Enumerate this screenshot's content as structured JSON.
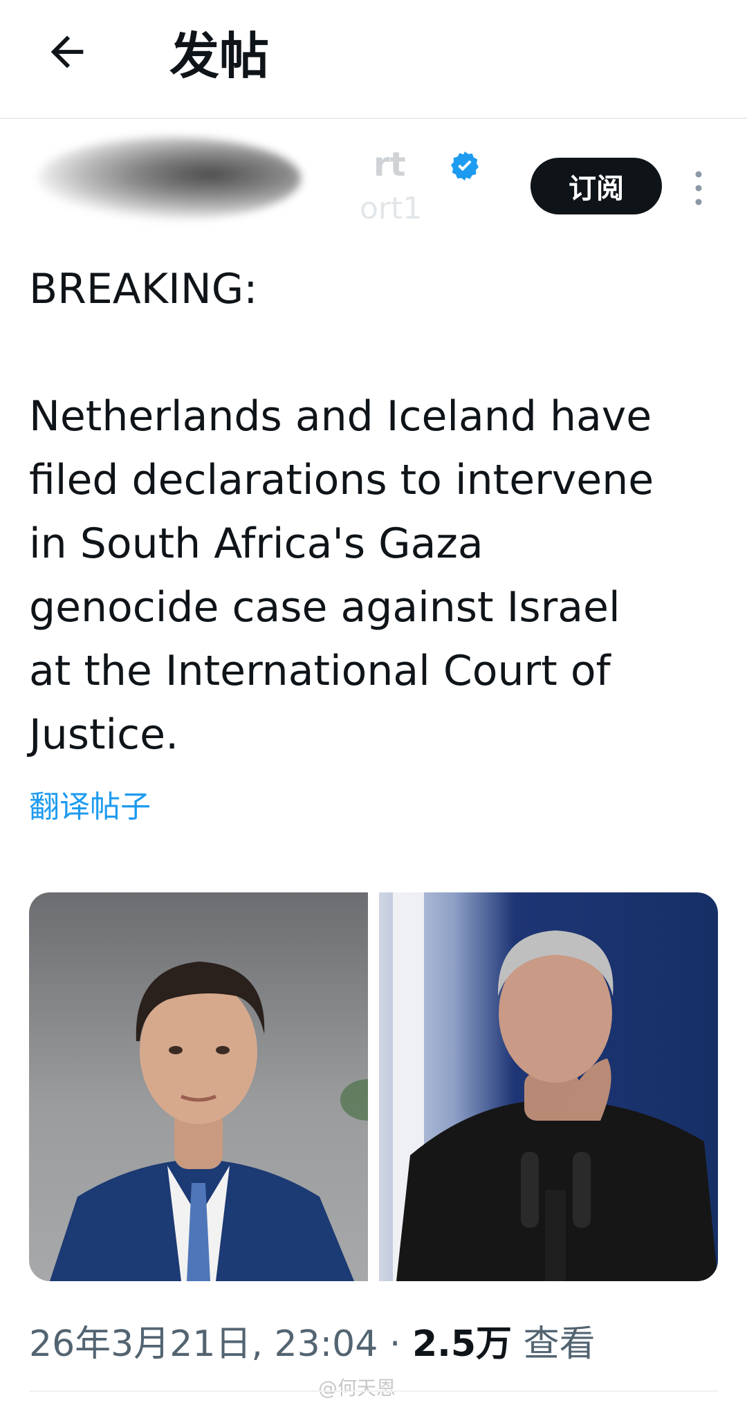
{
  "header": {
    "back_icon": "arrow-left-icon",
    "title": "发帖"
  },
  "author": {
    "name_fragment": "rt",
    "handle_fragment": "ort1",
    "verified_icon": "verified-badge-icon",
    "subscribe_label": "订阅",
    "more_icon": "more-vertical-icon"
  },
  "post": {
    "lines": [
      "BREAKING:",
      "",
      "Netherlands and Iceland have",
      "filed declarations to intervene",
      "in South Africa's Gaza",
      "genocide case against Israel",
      "at the International Court of",
      "Justice."
    ],
    "translate_link": "翻译帖子"
  },
  "meta": {
    "datetime": "26年3月21日, 23:04",
    "separator": "·",
    "views_count": "2.5万",
    "views_label": "查看"
  },
  "watermark": "@何天恩",
  "colors": {
    "accent": "#1d9bf0",
    "text": "#0f1419",
    "muted": "#536471",
    "button_bg": "#0f1419"
  }
}
